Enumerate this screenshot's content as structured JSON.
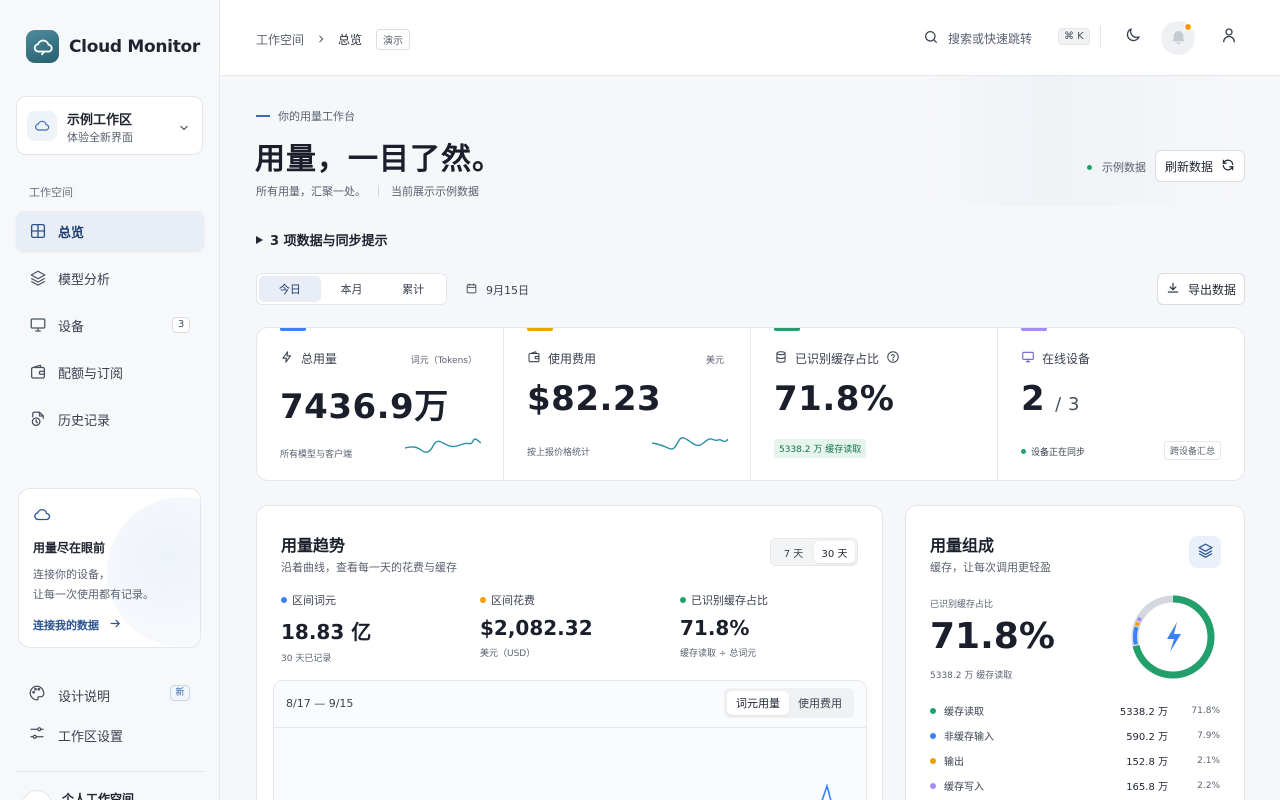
{
  "brand": {
    "name": "Cloud Monitor"
  },
  "workspace": {
    "title": "示例工作区",
    "subtitle": "体验全新界面"
  },
  "sidebar": {
    "section_label": "工作空间",
    "items": [
      {
        "label": "总览",
        "icon": "grid-icon",
        "active": true
      },
      {
        "label": "模型分析",
        "icon": "layers-icon"
      },
      {
        "label": "设备",
        "icon": "monitor-icon",
        "badge": "3"
      },
      {
        "label": "配额与订阅",
        "icon": "wallet-icon"
      },
      {
        "label": "历史记录",
        "icon": "history-icon"
      }
    ],
    "promo": {
      "title": "用量尽在眼前",
      "line1": "连接你的设备，",
      "line2": "让每一次使用都有记录。",
      "link": "连接我的数据"
    },
    "footer": [
      {
        "label": "设计说明",
        "badge": "新"
      },
      {
        "label": "工作区设置"
      }
    ],
    "personal": "个人工作空间"
  },
  "topbar": {
    "breadcrumb": [
      "工作空间",
      "总览"
    ],
    "demo_tag": "演示",
    "search_placeholder": "搜索或快速跳转",
    "shortcut": "⌘ K",
    "notification_dot_color": "#f59e0b"
  },
  "hero": {
    "eyebrow": "你的用量工作台",
    "title": "用量，一目了然。",
    "subtitle": "所有用量，汇聚一处。",
    "subtitle_note": "当前展示示例数据",
    "sample_label": "示例数据",
    "refresh_label": "刷新数据",
    "tips": "3 项数据与同步提示"
  },
  "filters": {
    "periods": [
      "今日",
      "本月",
      "累计"
    ],
    "active_period": "今日",
    "date": "9月15日",
    "export_label": "导出数据"
  },
  "kpis": [
    {
      "label": "总用量",
      "unit": "词元（Tokens）",
      "value": "7436.9万",
      "foot": "所有模型与客户端",
      "accent": "#3b82f6"
    },
    {
      "label": "使用费用",
      "unit": "美元",
      "value": "$82.23",
      "foot": "按上报价格统计",
      "accent": "#f59e0b"
    },
    {
      "label": "已识别缓存占比",
      "value": "71.8%",
      "chip": "5338.2 万 缓存读取",
      "accent": "#22a06b"
    },
    {
      "label": "在线设备",
      "value": "2",
      "denom": "/ 3",
      "status": "设备正在同步",
      "tag": "跨设备汇总",
      "accent": "#a78bfa"
    }
  ],
  "trend": {
    "title": "用量趋势",
    "subtitle": "沿着曲线，查看每一天的花费与缓存",
    "ranges": [
      "7 天",
      "30 天"
    ],
    "active_range": "30 天",
    "metrics": [
      {
        "label": "区间词元",
        "value": "18.83 亿",
        "note": "30 天已记录",
        "color": "#3b82f6"
      },
      {
        "label": "区间花费",
        "value": "$2,082.32",
        "note": "美元（USD）",
        "color": "#f59e0b"
      },
      {
        "label": "已识别缓存占比",
        "value": "71.8%",
        "note": "缓存读取 ÷ 总词元",
        "color": "#22a06b"
      }
    ],
    "chart": {
      "range": "8/17 — 9/15",
      "toggles": [
        "词元用量",
        "使用费用"
      ],
      "active_toggle": "词元用量"
    }
  },
  "composition": {
    "title": "用量组成",
    "subtitle": "缓存，让每次调用更轻盈",
    "label": "已识别缓存占比",
    "value": "71.8%",
    "note": "5338.2 万 缓存读取",
    "items": [
      {
        "label": "缓存读取",
        "value": "5338.2 万",
        "pct": "71.8%",
        "share": 71.8,
        "color": "#22a06b"
      },
      {
        "label": "非缓存输入",
        "value": "590.2 万",
        "pct": "7.9%",
        "share": 7.9,
        "color": "#3b82f6"
      },
      {
        "label": "输出",
        "value": "152.8 万",
        "pct": "2.1%",
        "share": 2.1,
        "color": "#f59e0b"
      },
      {
        "label": "缓存写入",
        "value": "165.8 万",
        "pct": "2.2%",
        "share": 2.2,
        "color": "#a78bfa"
      }
    ]
  }
}
